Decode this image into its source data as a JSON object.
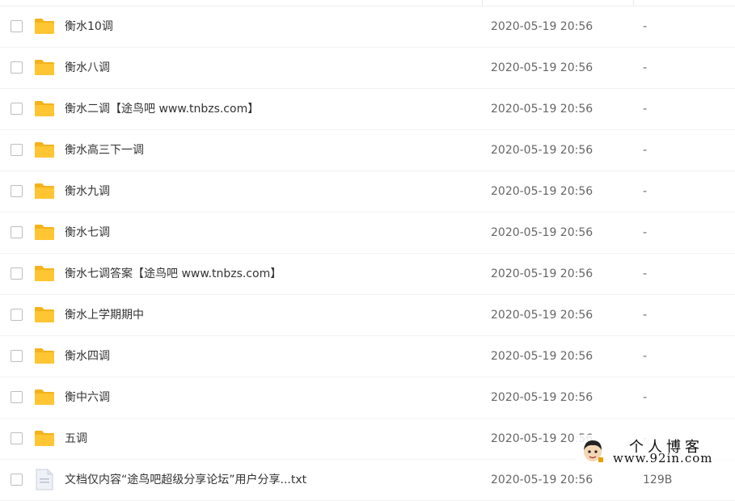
{
  "files": [
    {
      "name": "衡水10调",
      "date": "2020-05-19 20:56",
      "size": "-"
    },
    {
      "name": "衡水八调",
      "date": "2020-05-19 20:56",
      "size": "-"
    },
    {
      "name": "衡水二调【途鸟吧 www.tnbzs.com】",
      "date": "2020-05-19 20:56",
      "size": "-"
    },
    {
      "name": "衡水高三下一调",
      "date": "2020-05-19 20:56",
      "size": "-"
    },
    {
      "name": "衡水九调",
      "date": "2020-05-19 20:56",
      "size": "-"
    },
    {
      "name": "衡水七调",
      "date": "2020-05-19 20:56",
      "size": "-"
    },
    {
      "name": "衡水七调答案【途鸟吧 www.tnbzs.com】",
      "date": "2020-05-19 20:56",
      "size": "-"
    },
    {
      "name": "衡水上学期期中",
      "date": "2020-05-19 20:56",
      "size": "-"
    },
    {
      "name": "衡水四调",
      "date": "2020-05-19 20:56",
      "size": "-"
    },
    {
      "name": "衡中六调",
      "date": "2020-05-19 20:56",
      "size": "-"
    },
    {
      "name": "五调",
      "date": "2020-05-19 20:56",
      "size": "-"
    },
    {
      "name": "文档仅内容“途鸟吧超级分享论坛”用户分享...txt",
      "date": "2020-05-19 20:56",
      "size": "129B"
    }
  ],
  "icons": {
    "folder": "folder-icon",
    "document": "document-icon",
    "checkbox": "checkbox-icon"
  },
  "colors": {
    "folder": "#ffc533",
    "folder_tab": "#f5b21b",
    "text": "#333333",
    "muted": "#666666"
  },
  "watermark": {
    "line1": "个人博客",
    "line2": "www.92in.com"
  }
}
